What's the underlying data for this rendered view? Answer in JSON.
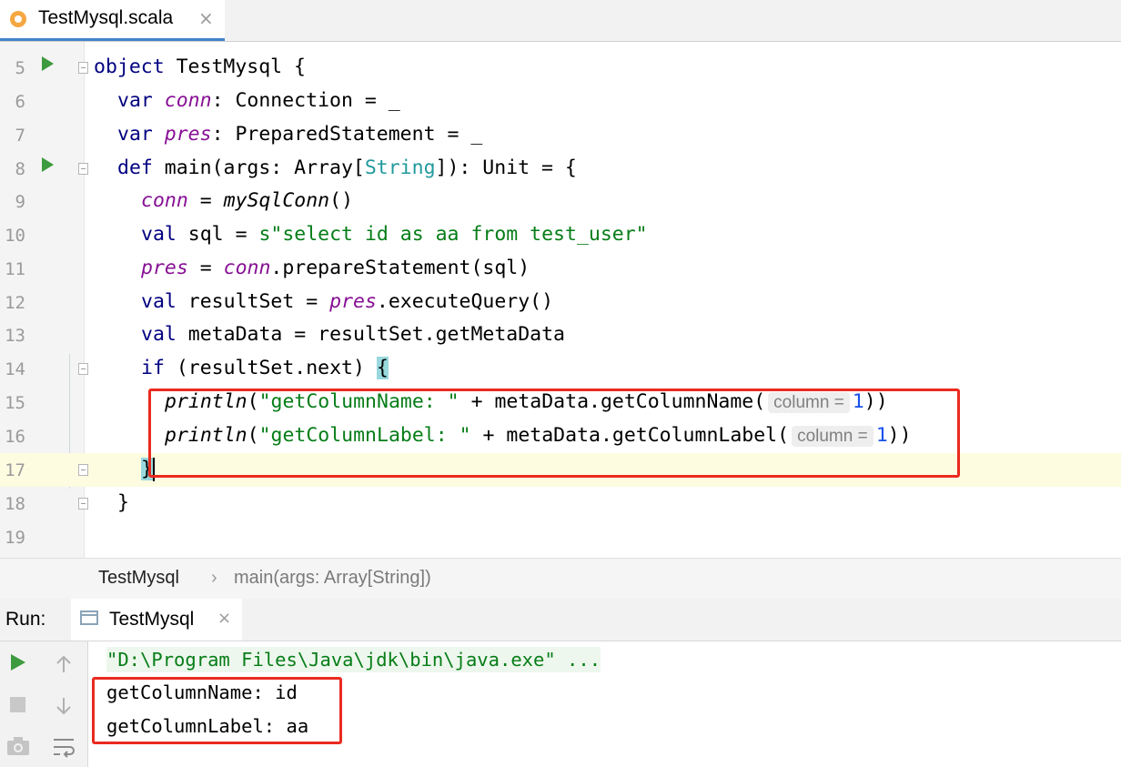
{
  "tab": {
    "title": "TestMysql.scala",
    "close": "×",
    "icon": "scala-object-icon"
  },
  "editor": {
    "lines": [
      {
        "num": "5"
      },
      {
        "num": "6"
      },
      {
        "num": "7"
      },
      {
        "num": "8"
      },
      {
        "num": "9"
      },
      {
        "num": "10"
      },
      {
        "num": "11"
      },
      {
        "num": "12"
      },
      {
        "num": "13"
      },
      {
        "num": "14"
      },
      {
        "num": "15"
      },
      {
        "num": "16"
      },
      {
        "num": "17"
      },
      {
        "num": "18"
      },
      {
        "num": "19"
      }
    ],
    "tokens": {
      "object_kw": "object",
      "object_name": " TestMysql {",
      "var_kw": "var",
      "conn": "conn",
      "conn_type": ": Connection = _",
      "pres": "pres",
      "pres_type": ": PreparedStatement = _",
      "def_kw": "def",
      "main_sig_a": " main(args: Array[",
      "string_type": "String",
      "main_sig_b": "]): Unit = {",
      "conn_assign": " = ",
      "mysqlconn": "mySqlConn",
      "parens": "()",
      "val_kw": "val",
      "sql_decl": " sql = ",
      "sql_str": "s\"select id as aa from test_user\"",
      "pres_assign": " = ",
      "prepare": ".prepareStatement(sql)",
      "resultset_decl": " resultSet = ",
      "execute": ".executeQuery()",
      "metadata_decl": " metaData = resultSet.getMetaData",
      "if_kw": "if",
      "if_cond": " (resultSet.next) ",
      "open_brace": "{",
      "println": "println",
      "open_paren": "(",
      "name_str": "\"getColumnName: \"",
      "name_call": " + metaData.getColumnName(",
      "label_str": "\"getColumnLabel: \"",
      "label_call": " + metaData.getColumnLabel(",
      "hint_column": "column =",
      "one": "1",
      "close_parens": "))",
      "close_brace": "}"
    }
  },
  "breadcrumbs": {
    "object": "TestMysql",
    "separator": "›",
    "method": "main(args: Array[String])"
  },
  "run_panel": {
    "label": "Run:",
    "tab_title": "TestMysql",
    "tab_close": "×",
    "console": [
      "\"D:\\Program Files\\Java\\jdk\\bin\\java.exe\" ...",
      "getColumnName: id",
      "getColumnLabel: aa"
    ]
  },
  "colors": {
    "keyword": "#000080",
    "field": "#871094",
    "string": "#067d17",
    "type": "#20999d",
    "number": "#1750eb",
    "highlight_box": "#ea2a1f"
  }
}
